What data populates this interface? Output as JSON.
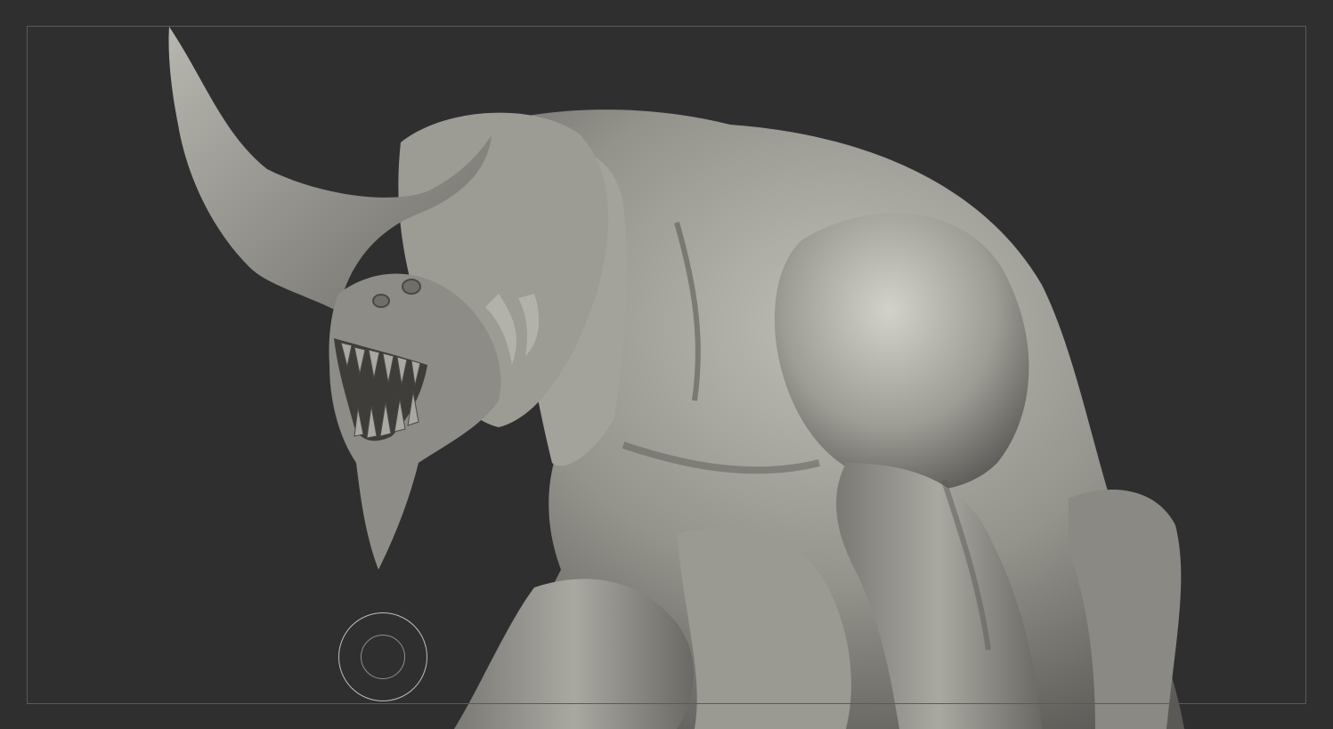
{
  "viewport": {
    "background_color": "#2f2f2f",
    "frame_color": "#5a5a5a",
    "model": {
      "icon": "creature-sculpt",
      "base_color": "#8f8e88",
      "highlight_color": "#c9c8c1",
      "shadow_color": "#3f3e3b"
    },
    "brush_cursor": {
      "icon": "brush-cursor-circle",
      "outer_color": "#bdbdbd",
      "inner_color": "#8e8e8e"
    }
  }
}
